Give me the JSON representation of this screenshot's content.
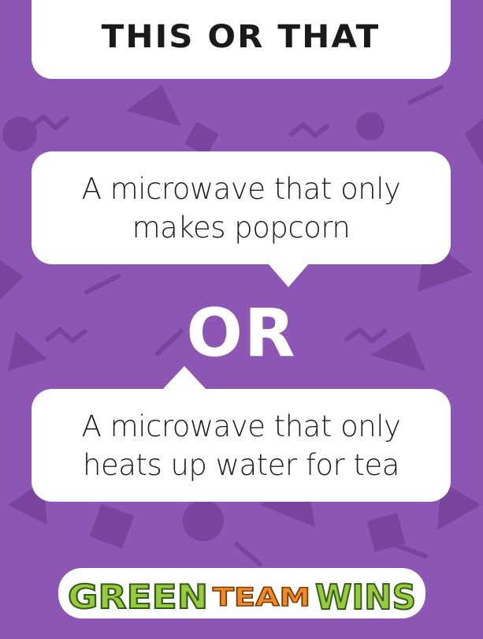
{
  "title": "THIS OR THAT",
  "option_a": {
    "line1": "A microwave that only",
    "line2": "makes popcorn"
  },
  "separator": "OR",
  "option_b": {
    "line1": "A microwave that only",
    "line2": "heats up water for tea"
  },
  "logo": {
    "word1": "GREEN",
    "word2": "TEAM",
    "word3": "WINS"
  },
  "colors": {
    "background": "#8e56b4",
    "pattern": "#7b449f",
    "card": "#ffffff",
    "logo_green": "#9ac93b",
    "logo_orange": "#f08a24"
  }
}
